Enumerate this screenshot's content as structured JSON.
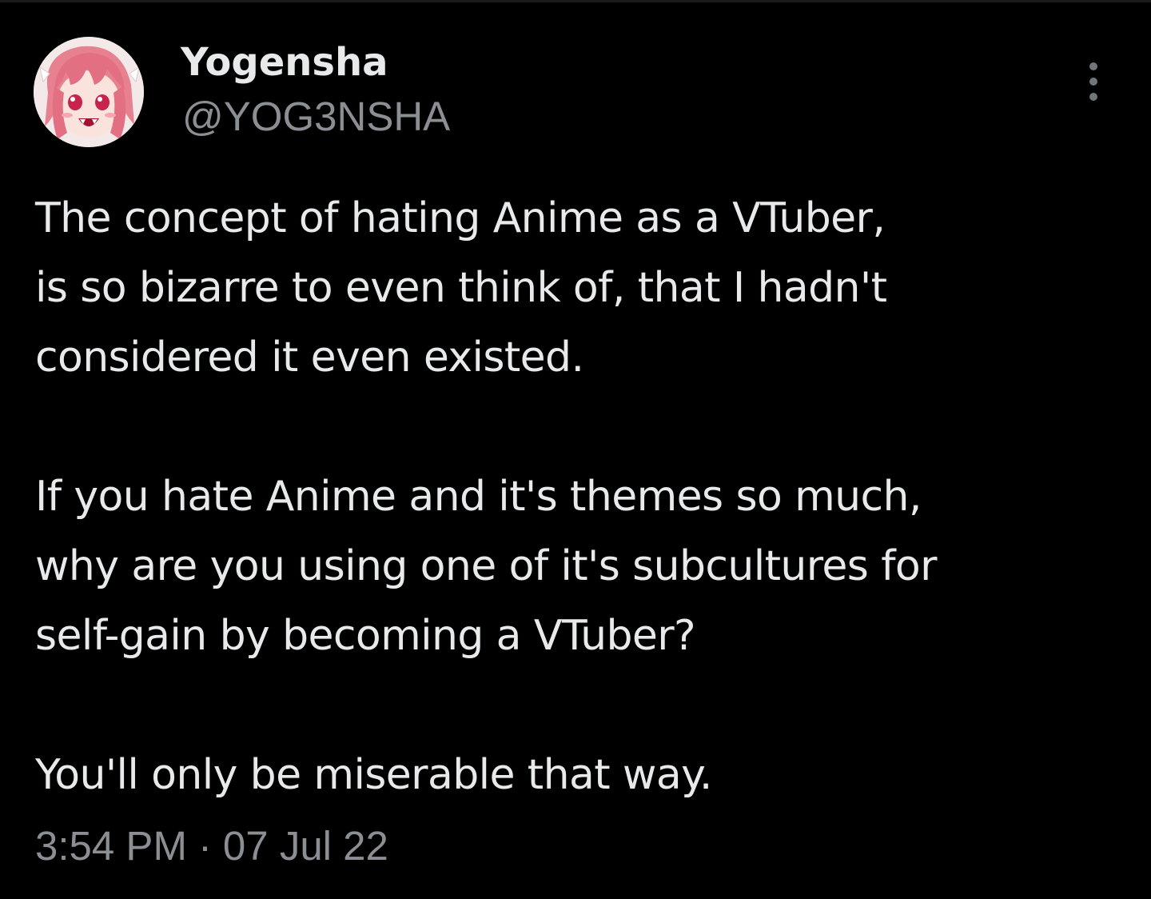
{
  "author": {
    "display_name": "Yogensha",
    "handle": "@YOG3NSHA",
    "avatar_icon": "anime-girl-avatar-icon"
  },
  "menu": {
    "more_icon": "more-vertical-icon"
  },
  "tweet": {
    "paragraphs": [
      {
        "lines": [
          "The concept of hating Anime as a VTuber,",
          "is so bizarre to even think of, that I hadn't",
          "considered it even existed."
        ]
      },
      {
        "lines": [
          "If you hate Anime and it's themes so much,",
          "why are you using one of it's subcultures for",
          "self-gain by becoming a VTuber?"
        ]
      },
      {
        "lines": [
          "You'll only be miserable that way."
        ]
      }
    ],
    "time": "3:54 PM",
    "separator": "·",
    "date": "07 Jul 22"
  },
  "colors": {
    "background": "#000000",
    "primary_text": "#e7e9ea",
    "secondary_text": "#8b8f94"
  }
}
